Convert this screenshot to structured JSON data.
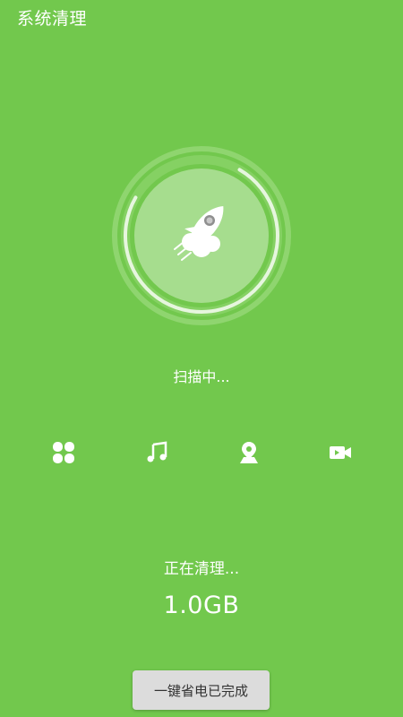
{
  "header": {
    "title": "系统清理"
  },
  "scan": {
    "status_text": "扫描中...",
    "progress": 0.75
  },
  "categories": [
    {
      "name": "apps",
      "icon": "apps-grid-icon"
    },
    {
      "name": "music",
      "icon": "music-note-icon"
    },
    {
      "name": "location",
      "icon": "map-pin-icon"
    },
    {
      "name": "video",
      "icon": "video-camera-icon"
    }
  ],
  "clean": {
    "status_text": "正在清理...",
    "size_text": "1.0GB"
  },
  "action": {
    "button_label": "一键省电已完成"
  },
  "colors": {
    "background": "#72c84d",
    "ring_light": "#a6dd8e",
    "ring_track": "#8fd56f",
    "button_bg": "#dcdcdc"
  }
}
